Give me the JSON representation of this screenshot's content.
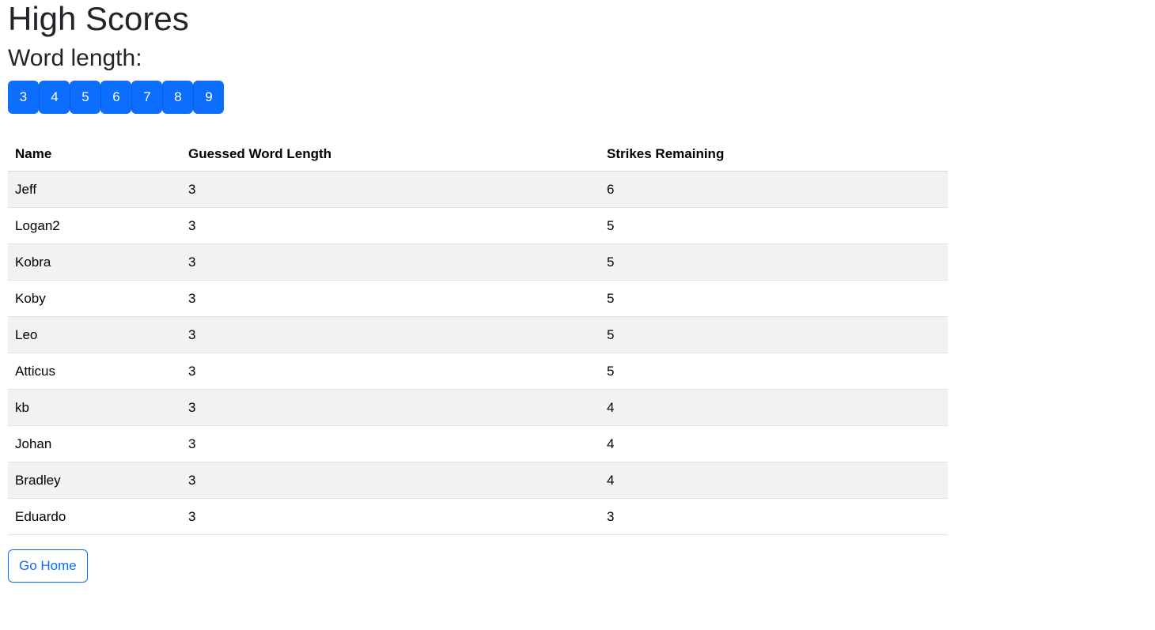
{
  "page": {
    "title": "High Scores",
    "subtitle": "Word length:"
  },
  "word_length_buttons": [
    "3",
    "4",
    "5",
    "6",
    "7",
    "8",
    "9"
  ],
  "table": {
    "headers": [
      "Name",
      "Guessed Word Length",
      "Strikes Remaining"
    ],
    "rows": [
      [
        "Jeff",
        "3",
        "6"
      ],
      [
        "Logan2",
        "3",
        "5"
      ],
      [
        "Kobra",
        "3",
        "5"
      ],
      [
        "Koby",
        "3",
        "5"
      ],
      [
        "Leo",
        "3",
        "5"
      ],
      [
        "Atticus",
        "3",
        "5"
      ],
      [
        "kb",
        "3",
        "4"
      ],
      [
        "Johan",
        "3",
        "4"
      ],
      [
        "Bradley",
        "3",
        "4"
      ],
      [
        "Eduardo",
        "3",
        "3"
      ]
    ]
  },
  "footer": {
    "home_label": "Go Home"
  },
  "colors": {
    "primary": "#0d6efd",
    "stripe": "#f2f2f2",
    "text": "#212529"
  }
}
